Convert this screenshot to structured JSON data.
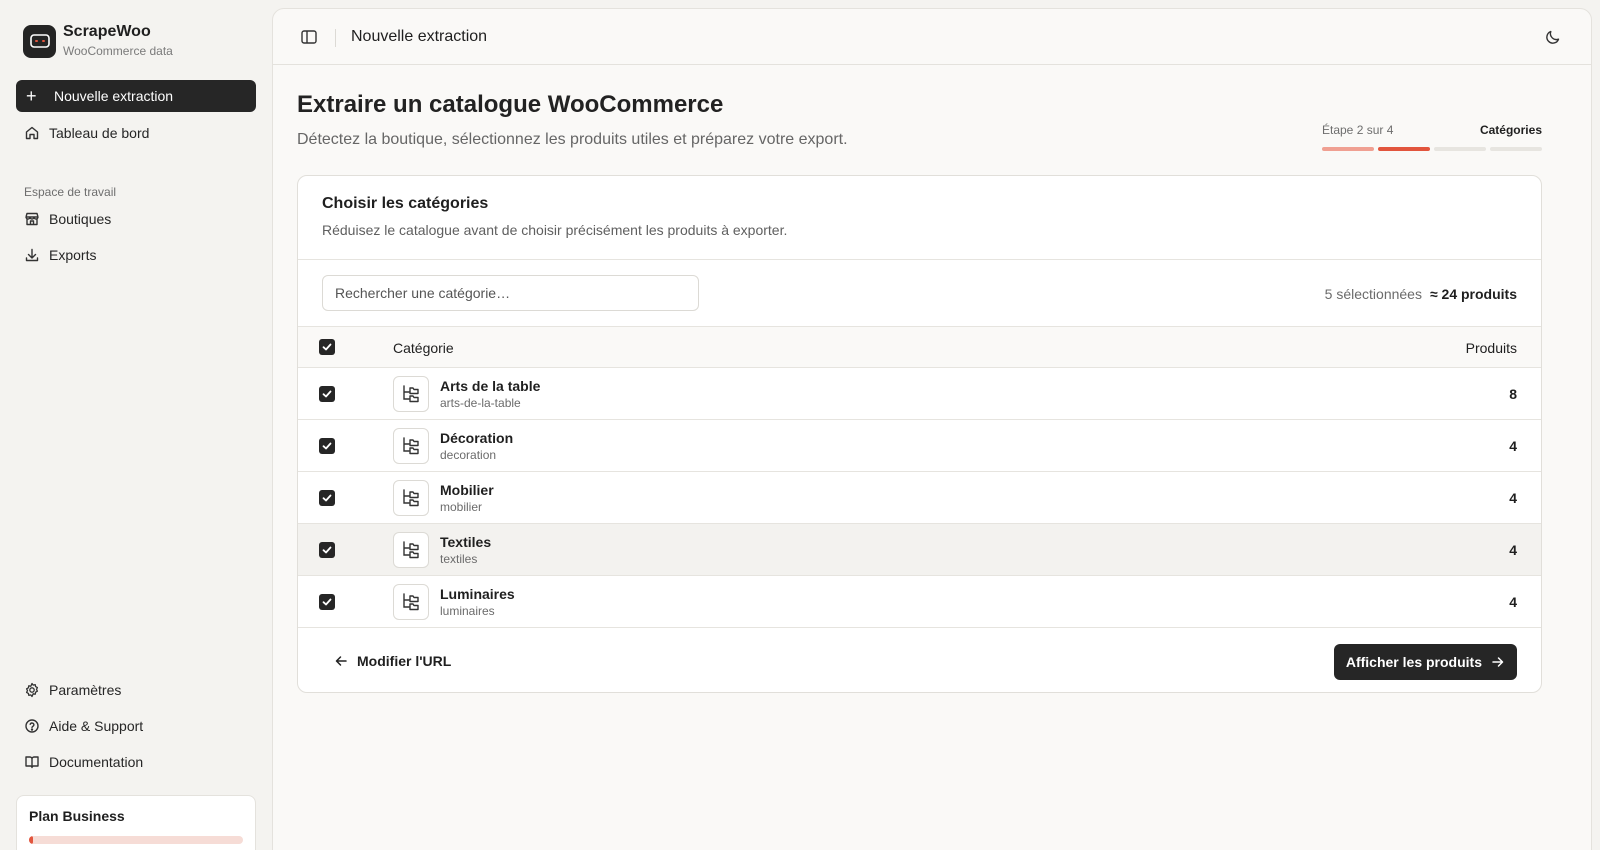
{
  "brand": {
    "name": "ScrapeWoo",
    "subtitle": "WooCommerce data"
  },
  "sidebar": {
    "primary_action": "Nouvelle extraction",
    "dashboard": "Tableau de bord",
    "section_label": "Espace de travail",
    "workspace": [
      {
        "label": "Boutiques",
        "icon": "store-icon"
      },
      {
        "label": "Exports",
        "icon": "download-icon"
      }
    ],
    "bottom": [
      {
        "label": "Paramètres",
        "icon": "gear-icon"
      },
      {
        "label": "Aide & Support",
        "icon": "help-circle-icon"
      },
      {
        "label": "Documentation",
        "icon": "book-icon"
      }
    ],
    "plan": {
      "name": "Plan Business",
      "usage_fraction": 0.02
    }
  },
  "topbar": {
    "title": "Nouvelle extraction"
  },
  "page": {
    "title": "Extraire un catalogue WooCommerce",
    "subtitle": "Détectez la boutique, sélectionnez les produits utiles et préparez votre export."
  },
  "stepper": {
    "label": "Étape 2 sur 4",
    "current_name": "Catégories",
    "current": 2,
    "total": 4
  },
  "card": {
    "title": "Choisir les catégories",
    "description": "Réduisez le catalogue avant de choisir précisément les produits à exporter.",
    "search_placeholder": "Rechercher une catégorie…",
    "selected_count": "5 sélectionnées",
    "selected_total": "≈ 24 produits",
    "columns": {
      "category": "Catégorie",
      "products": "Produits"
    },
    "rows": [
      {
        "name": "Arts de la table",
        "slug": "arts-de-la-table",
        "count": "8",
        "checked": true
      },
      {
        "name": "Décoration",
        "slug": "decoration",
        "count": "4",
        "checked": true
      },
      {
        "name": "Mobilier",
        "slug": "mobilier",
        "count": "4",
        "checked": true
      },
      {
        "name": "Textiles",
        "slug": "textiles",
        "count": "4",
        "checked": true
      },
      {
        "name": "Luminaires",
        "slug": "luminaires",
        "count": "4",
        "checked": true
      }
    ],
    "back_label": "Modifier l'URL",
    "next_label": "Afficher les produits"
  },
  "colors": {
    "accent": "#e2553d",
    "accent_light": "#f0a092",
    "dark": "#262626"
  }
}
